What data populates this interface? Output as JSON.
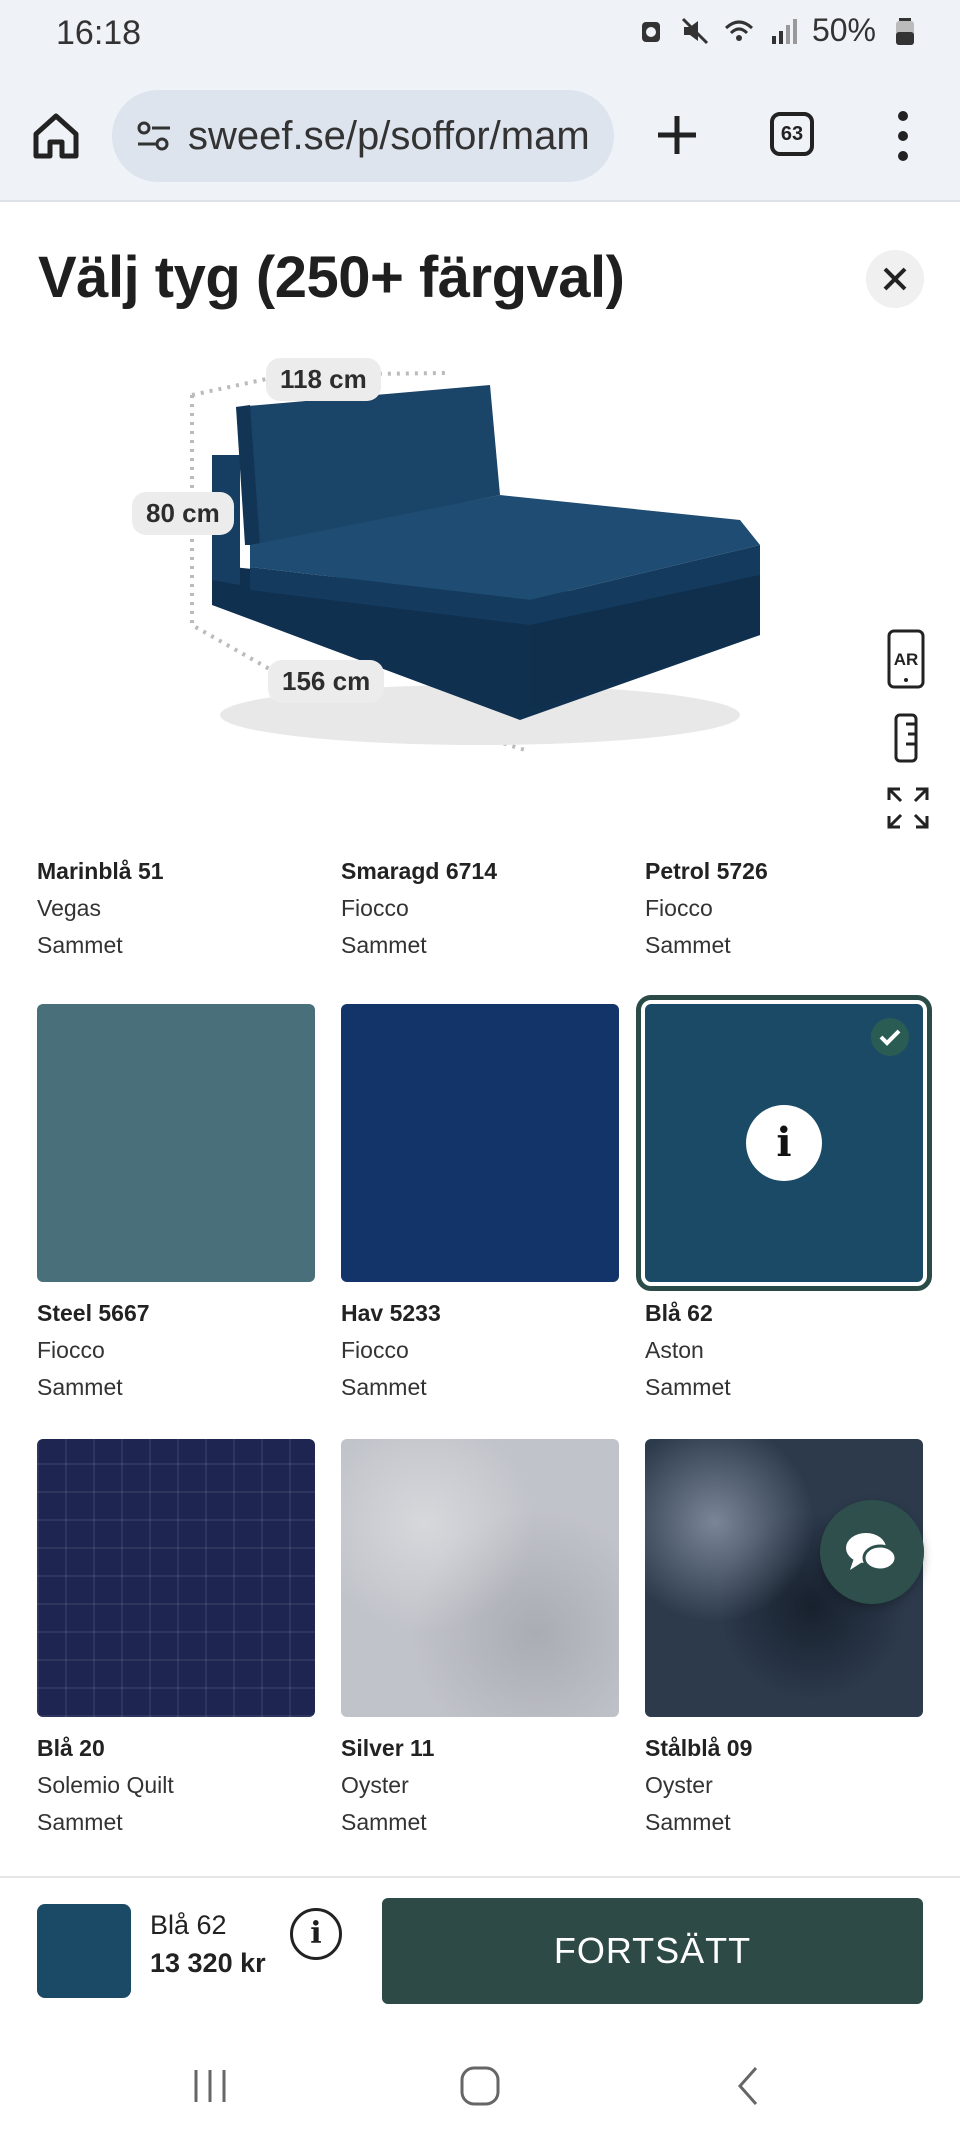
{
  "status": {
    "time": "16:18",
    "battery": "50%"
  },
  "browser": {
    "url": "sweef.se/p/soffor/mam",
    "tab_count": "63"
  },
  "header": {
    "title": "Välj tyg (250+ färgval)"
  },
  "dimensions": {
    "width": "118 cm",
    "height": "80 cm",
    "depth": "156 cm"
  },
  "view_tools": {
    "ar_label": "AR"
  },
  "fabrics": [
    {
      "name": "Marinblå 51",
      "collection": "Vegas",
      "material": "Sammet",
      "color": "#27304b"
    },
    {
      "name": "Smaragd 6714",
      "collection": "Fiocco",
      "material": "Sammet",
      "color": "#1f4a3e"
    },
    {
      "name": "Petrol 5726",
      "collection": "Fiocco",
      "material": "Sammet",
      "color": "#1d4a52"
    },
    {
      "name": "Steel 5667",
      "collection": "Fiocco",
      "material": "Sammet",
      "color": "#49707a"
    },
    {
      "name": "Hav 5233",
      "collection": "Fiocco",
      "material": "Sammet",
      "color": "#123468"
    },
    {
      "name": "Blå 62",
      "collection": "Aston",
      "material": "Sammet",
      "color": "#1a4a66",
      "selected": true
    },
    {
      "name": "Blå 20",
      "collection": "Solemio Quilt",
      "material": "Sammet",
      "color": "#1d2550"
    },
    {
      "name": "Silver 11",
      "collection": "Oyster",
      "material": "Sammet",
      "color": "#c0c3c9"
    },
    {
      "name": "Stålblå 09",
      "collection": "Oyster",
      "material": "Sammet",
      "color": "#2c3a4c"
    }
  ],
  "selection": {
    "name": "Blå 62",
    "price": "13 320 kr"
  },
  "actions": {
    "continue_label": "FORTSÄTT"
  }
}
